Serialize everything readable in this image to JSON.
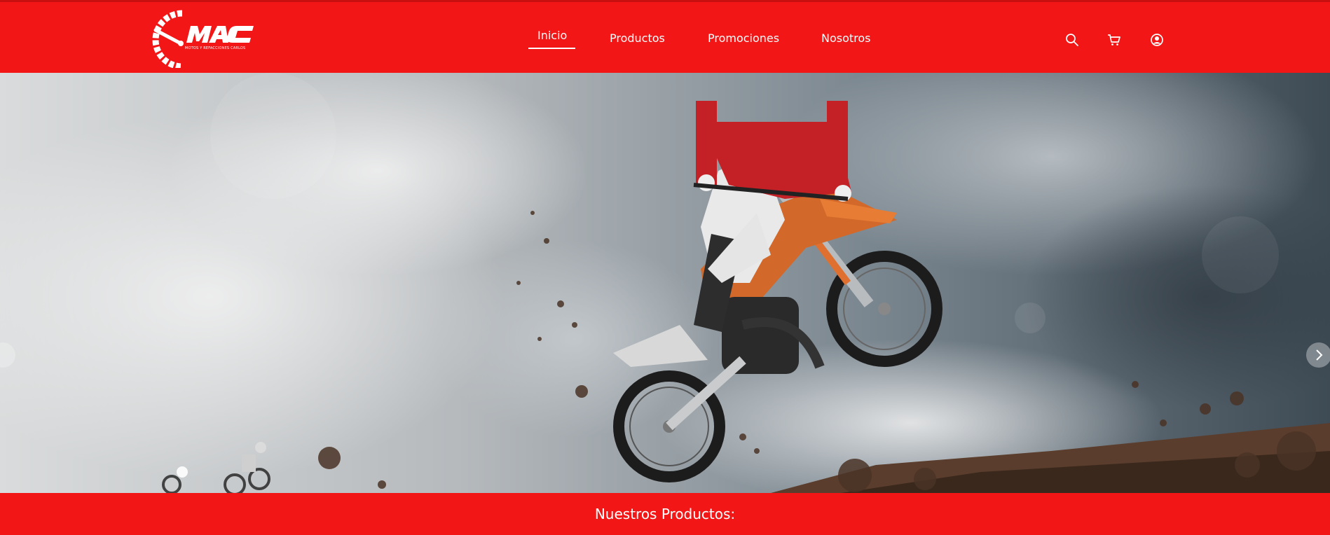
{
  "brand": {
    "logo_text": "MAC",
    "tagline": "MOTOS Y REFACCIONES CARLOS"
  },
  "nav": {
    "items": [
      {
        "label": "Inicio",
        "active": true
      },
      {
        "label": "Productos",
        "active": false
      },
      {
        "label": "Promociones",
        "active": false
      },
      {
        "label": "Nosotros",
        "active": false
      }
    ]
  },
  "header_icons": [
    "search-icon",
    "cart-icon",
    "user-account-icon"
  ],
  "hero": {
    "image": "motocross rider jumping dirt bike against stormy sky"
  },
  "section": {
    "title": "Nuestros Productos:"
  },
  "colors": {
    "brand_red": "#f21616",
    "text": "#ffffff"
  }
}
